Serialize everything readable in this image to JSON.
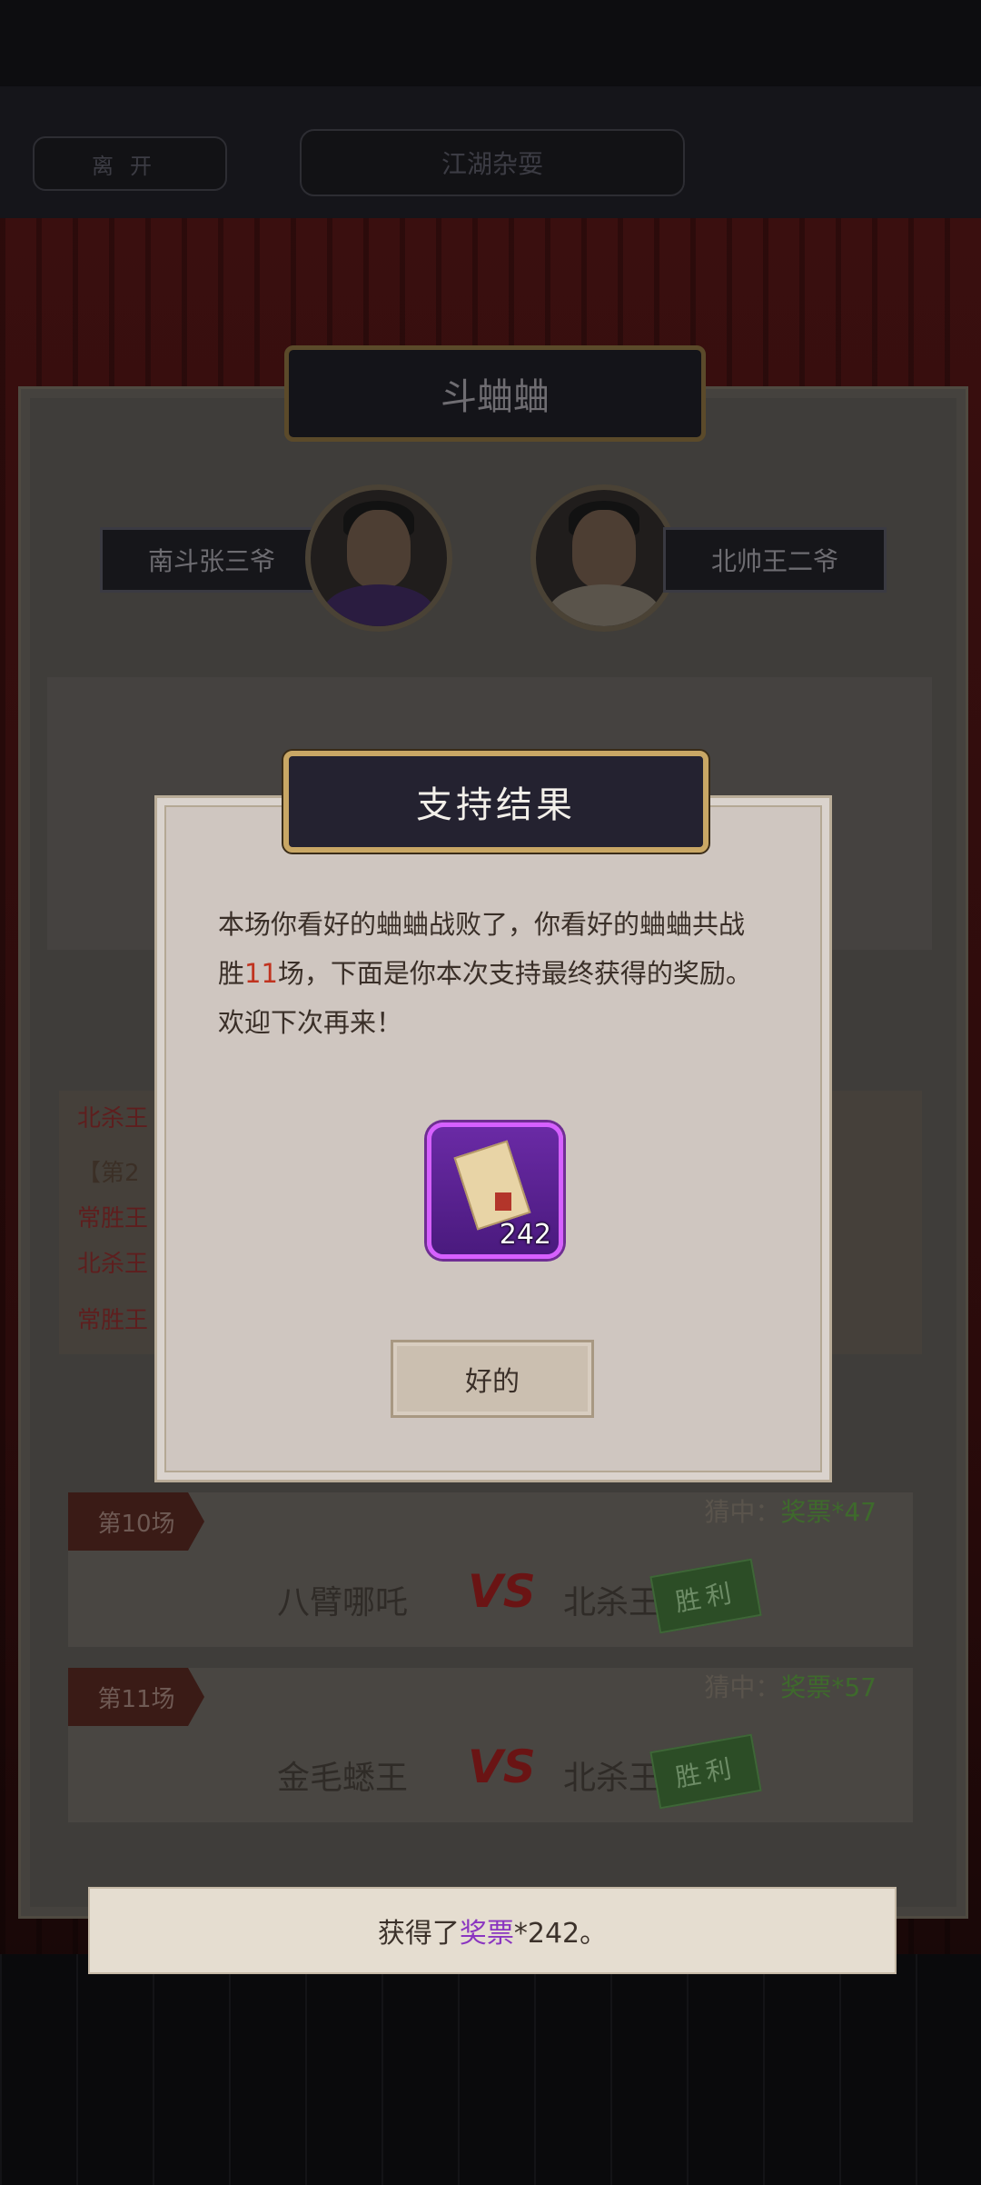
{
  "header": {
    "leave_label": "离开",
    "title": "江湖杂耍"
  },
  "panel": {
    "title": "斗蛐蛐"
  },
  "players": {
    "left": {
      "name": "南斗张三爷"
    },
    "right": {
      "name": "北帅王二爷"
    }
  },
  "log": {
    "lines": [
      "北杀王",
      "【第2",
      "常胜王",
      "北杀王",
      "常胜王"
    ]
  },
  "matches": [
    {
      "label": "第10场",
      "guess_prefix": "猜中：",
      "guess_reward": "奖票*47",
      "left": "八臂哪吒",
      "vs": "VS",
      "right": "北杀王",
      "stamp": "胜利"
    },
    {
      "label": "第11场",
      "guess_prefix": "猜中：",
      "guess_reward": "奖票*57",
      "left": "金毛蟋王",
      "vs": "VS",
      "right": "北杀王",
      "stamp": "胜利"
    }
  ],
  "dialog": {
    "title": "支持结果",
    "message_part1": "本场你看好的蛐蛐战败了，你看好的蛐蛐共战胜",
    "wins": "11",
    "message_part2": "场，下面是你本次支持最终获得的奖励。欢迎下次再来！",
    "reward_count": "242",
    "ok_label": "好的"
  },
  "toast": {
    "prefix": "获得了",
    "item": "奖票",
    "suffix": "*242。"
  },
  "colors": {
    "accent_gold": "#c9a765",
    "reward_purple": "#d660ff",
    "win_green": "#2c4d26",
    "highlight_red": "#c0331f"
  }
}
